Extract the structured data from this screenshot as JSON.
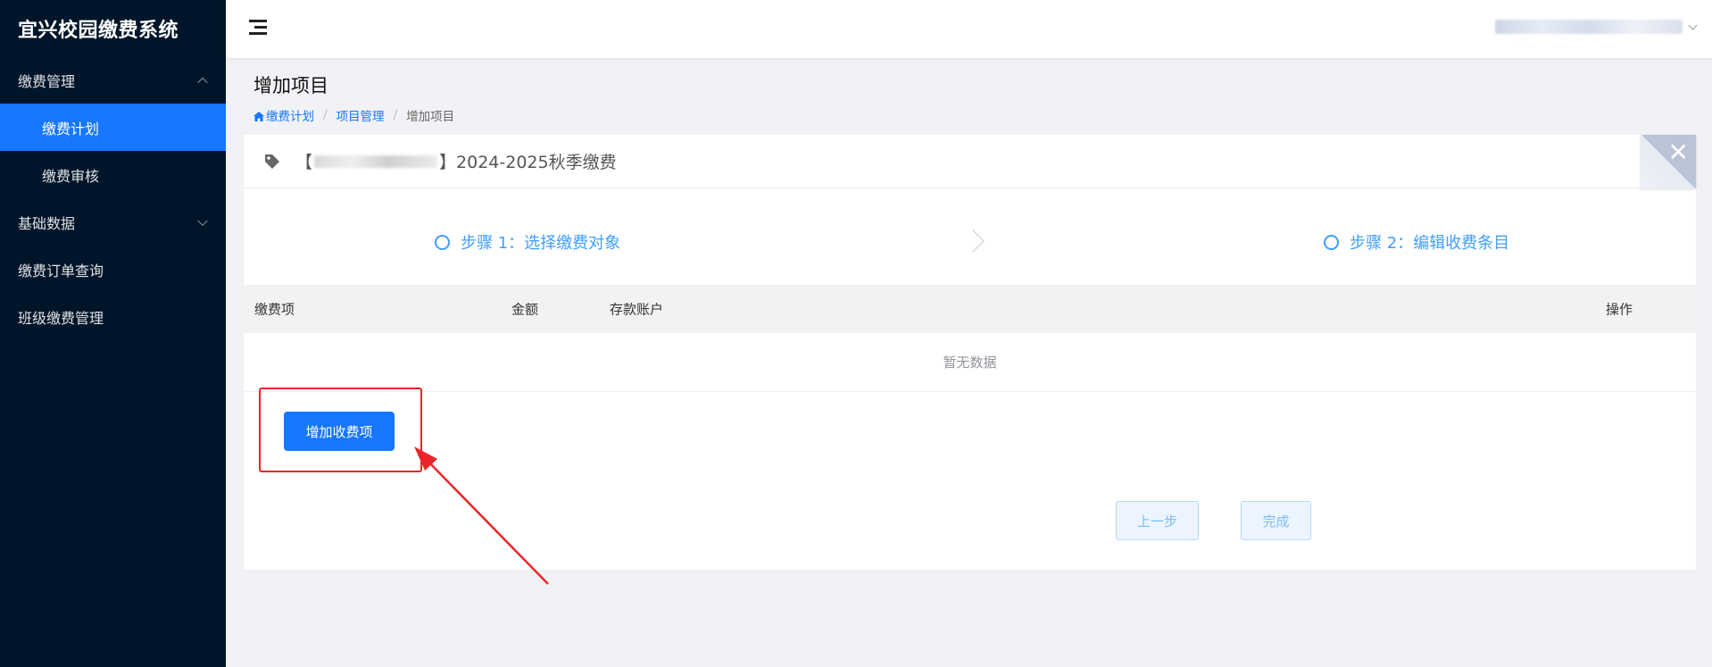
{
  "app": {
    "title": "宜兴校园缴费系统"
  },
  "sidebar": {
    "items": [
      {
        "label": "缴费管理"
      },
      {
        "label": "缴费计划"
      },
      {
        "label": "缴费审核"
      },
      {
        "label": "基础数据"
      },
      {
        "label": "缴费订单查询"
      },
      {
        "label": "班级缴费管理"
      }
    ]
  },
  "page": {
    "title": "增加项目",
    "breadcrumb": [
      "缴费计划",
      "项目管理",
      "增加项目"
    ]
  },
  "card": {
    "title_prefix": "【",
    "title_suffix": "】2024-2025秋季缴费"
  },
  "steps": [
    {
      "label": "步骤 1：选择缴费对象"
    },
    {
      "label": "步骤 2：编辑收费条目"
    }
  ],
  "table": {
    "columns": [
      "缴费项",
      "金额",
      "存款账户",
      "操作"
    ],
    "empty_text": "暂无数据"
  },
  "buttons": {
    "add_fee_item": "增加收费项",
    "prev": "上一步",
    "done": "完成"
  },
  "colors": {
    "sidebar_bg": "#001529",
    "primary": "#1677ff",
    "step_blue": "#409eff",
    "annotation_red": "#e8262b"
  },
  "icons": {
    "menu": "hamburger-icon",
    "home": "home-icon",
    "tag": "tag-icon",
    "close": "close-icon"
  }
}
